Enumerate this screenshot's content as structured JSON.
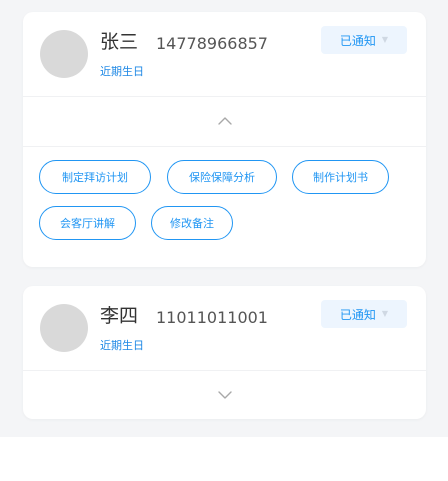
{
  "contacts": [
    {
      "name": "张三",
      "phone": "14778966857",
      "tag": "近期生日",
      "status": "已通知",
      "expanded": true,
      "actions": [
        "制定拜访计划",
        "保险保障分析",
        "制作计划书",
        "会客厅讲解",
        "修改备注"
      ]
    },
    {
      "name": "李四",
      "phone": "11011011001",
      "tag": "近期生日",
      "status": "已通知",
      "expanded": false
    }
  ],
  "colors": {
    "accent": "#2196f3",
    "status_bg": "#edf5fe",
    "avatar": "#d9d9d9",
    "background": "#f4f5f7"
  },
  "icons": {
    "collapse": "chevron-up-icon",
    "expand": "chevron-down-icon",
    "status_caret": "caret-down-icon"
  }
}
